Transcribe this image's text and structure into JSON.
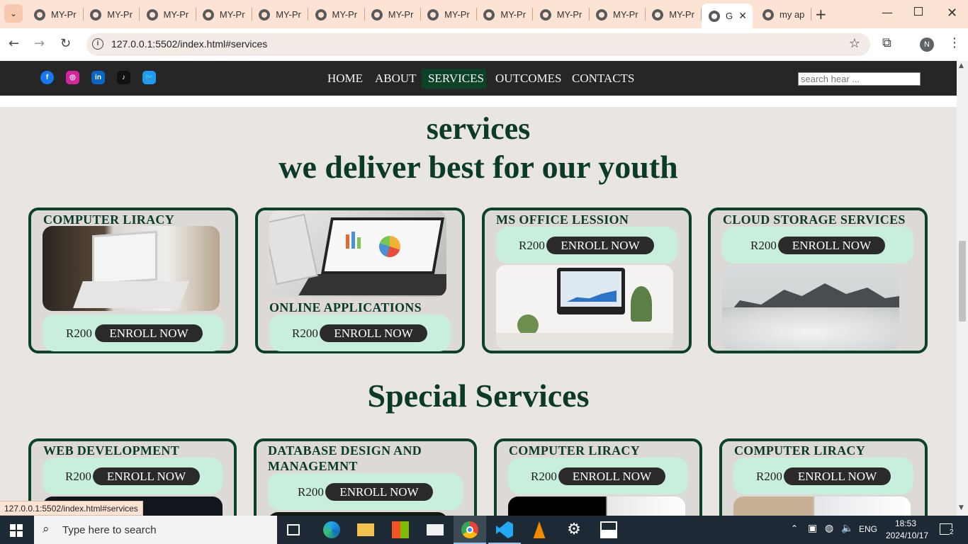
{
  "browser": {
    "tabs": [
      {
        "title": "MY-Pr"
      },
      {
        "title": "MY-Pr"
      },
      {
        "title": "MY-Pr"
      },
      {
        "title": "MY-Pr"
      },
      {
        "title": "MY-Pr"
      },
      {
        "title": "MY-Pr"
      },
      {
        "title": "MY-Pr"
      },
      {
        "title": "MY-Pr"
      },
      {
        "title": "MY-Pr"
      },
      {
        "title": "MY-Pr"
      },
      {
        "title": "MY-Pr"
      },
      {
        "title": "MY-Pr"
      }
    ],
    "active_tab": {
      "title": "G"
    },
    "last_tab": {
      "title": "my ap"
    },
    "url": "127.0.0.1:5502/index.html#services",
    "profile_initial": "N",
    "status_url": "127.0.0.1:5502/index.html#services"
  },
  "navbar": {
    "social": [
      {
        "name": "facebook-icon",
        "letter": "f",
        "color": "#1877f2"
      },
      {
        "name": "instagram-icon",
        "letter": "◎",
        "color": "#d6249f"
      },
      {
        "name": "linkedin-icon",
        "letter": "in",
        "color": "#0a66c2"
      },
      {
        "name": "tiktok-icon",
        "letter": "♪",
        "color": "#111111"
      },
      {
        "name": "twitter-icon",
        "letter": "🐦",
        "color": "#1d9bf0"
      }
    ],
    "links": [
      "HOME",
      "ABOUT",
      "SERVICES",
      "OUTCOMES",
      "CONTACTS"
    ],
    "search_placeholder": "search hear ..."
  },
  "services": {
    "heading1": "services",
    "heading2": "we deliver best for our youth",
    "cards": [
      {
        "title": "COMPUTER LIRACY",
        "price": "R200",
        "button": "ENROLL NOW"
      },
      {
        "title": "ONLINE APPLICATIONS",
        "price": "R200",
        "button": "ENROLL NOW"
      },
      {
        "title": "MS OFFICE LESSION",
        "price": "R200",
        "button": "ENROLL NOW"
      },
      {
        "title": "CLOUD STORAGE SERVICES",
        "price": "R200",
        "button": "ENROLL NOW"
      }
    ]
  },
  "special": {
    "heading": "Special Services",
    "cards": [
      {
        "title": "WEB DEVELOPMENT",
        "price": "R200",
        "button": "ENROLL NOW"
      },
      {
        "title": "DATABASE DESIGN AND MANAGEMNT",
        "price": "R200",
        "button": "ENROLL NOW"
      },
      {
        "title": "COMPUTER LIRACY",
        "price": "R200",
        "button": "ENROLL NOW"
      },
      {
        "title": "COMPUTER LIRACY",
        "price": "R200",
        "button": "ENROLL NOW"
      }
    ]
  },
  "taskbar": {
    "search_text": "Type here to search",
    "lang": "ENG",
    "time": "18:53",
    "date": "2024/10/17",
    "notifications": "2"
  }
}
